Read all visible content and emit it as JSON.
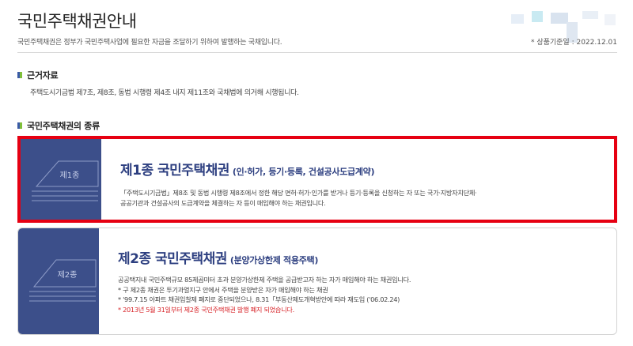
{
  "header": {
    "title": "국민주택채권안내",
    "subtitle": "국민주택채권은 정부가 국민주택사업에 필요한 자금을 조달하기 위하여 발행하는 국채입니다.",
    "date": "* 상품기준일 : 2022.12.01"
  },
  "sections": {
    "basis_title": "근거자료",
    "basis_text": "주택도시기금법 제7조, 제8조, 동법 시행령 제4조 내지 제11조와 국채법에 의거해 시행됩니다.",
    "types_title": "국민주택채권의 종류"
  },
  "cards": [
    {
      "badge": "제1종",
      "title": "제1종 국민주택채권",
      "subtitle": "(인·허가, 등기·등록, 건설공사도급계약)",
      "desc_lines": [
        "「주택도시기금법」제8조 및 동법 시행령 제8조에서 정한 해당 면허·허가·인가를 받거나 등기·등록을 신청하는 자 또는 국가·지방자치단체·",
        "공공기관과 건설공사의 도급계약을 체결하는 자 등이 매입해야 하는 채권입니다."
      ]
    },
    {
      "badge": "제2종",
      "title": "제2종 국민주택채권",
      "subtitle": "(분양가상한제 적용주택)",
      "desc_lines": [
        "공공택지내 국민주택규모 85제곱미터 초과 분양가상한제 주택을 공급받고자 하는 자가 매입해야 하는 채권입니다.",
        "* 구 제2종 채권은 투기과열지구 안에서 주택을 분양받은 자가 매입해야 하는 채권",
        "* '99.7.15 아파트 채권입찰제 폐지로 중단되었으나, 8.31「부동산제도개혁방안에 따라 재도입 ('06.02.24)"
      ],
      "notice": "* 2013년 5월 31일부터 제2종 국민주택채권 발행 폐지 되었습니다."
    }
  ],
  "colors": {
    "accent_blue": "#3c4f8a",
    "title_blue": "#2d3f80",
    "highlight_red": "#e60012",
    "notice_red": "#d8262b",
    "bullet_green": "#7fbf3a"
  }
}
